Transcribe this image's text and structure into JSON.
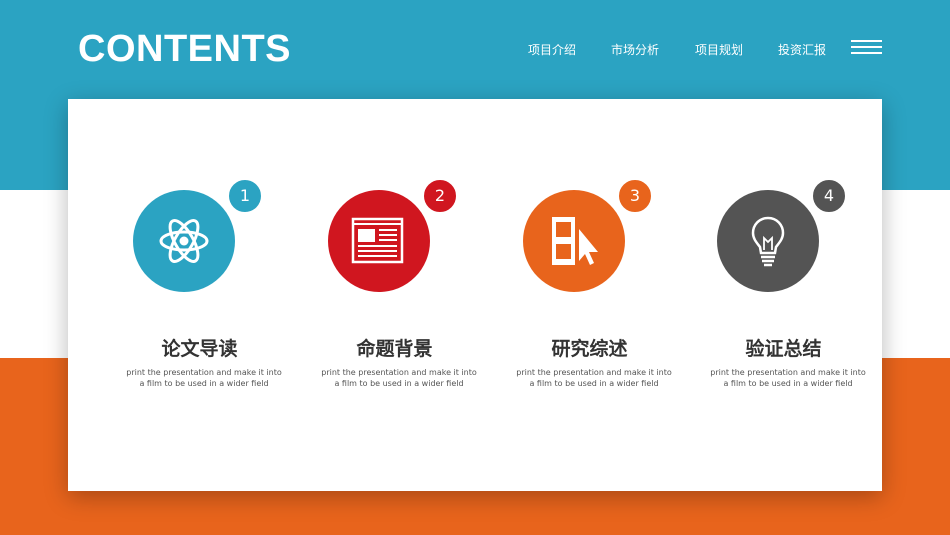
{
  "title": "CONTENTS",
  "nav": [
    "项目介绍",
    "市场分析",
    "项目规划",
    "投资汇报"
  ],
  "items": [
    {
      "number": "1",
      "label": "论文导读",
      "desc": "print the presentation and make it into a film to be used in a wider field",
      "icon": "atom-icon",
      "color": "#2ba3c2"
    },
    {
      "number": "2",
      "label": "命题背景",
      "desc": "print the presentation and make it into a film to be used in a wider field",
      "icon": "document-icon",
      "color": "#d0161f"
    },
    {
      "number": "3",
      "label": "研究综述",
      "desc": "print the presentation and make it into a film to be used in a wider field",
      "icon": "cursor-panel-icon",
      "color": "#e8641c"
    },
    {
      "number": "4",
      "label": "验证总结",
      "desc": "print the presentation and make it into a film to be used in a wider field",
      "icon": "lightbulb-icon",
      "color": "#545454"
    }
  ]
}
